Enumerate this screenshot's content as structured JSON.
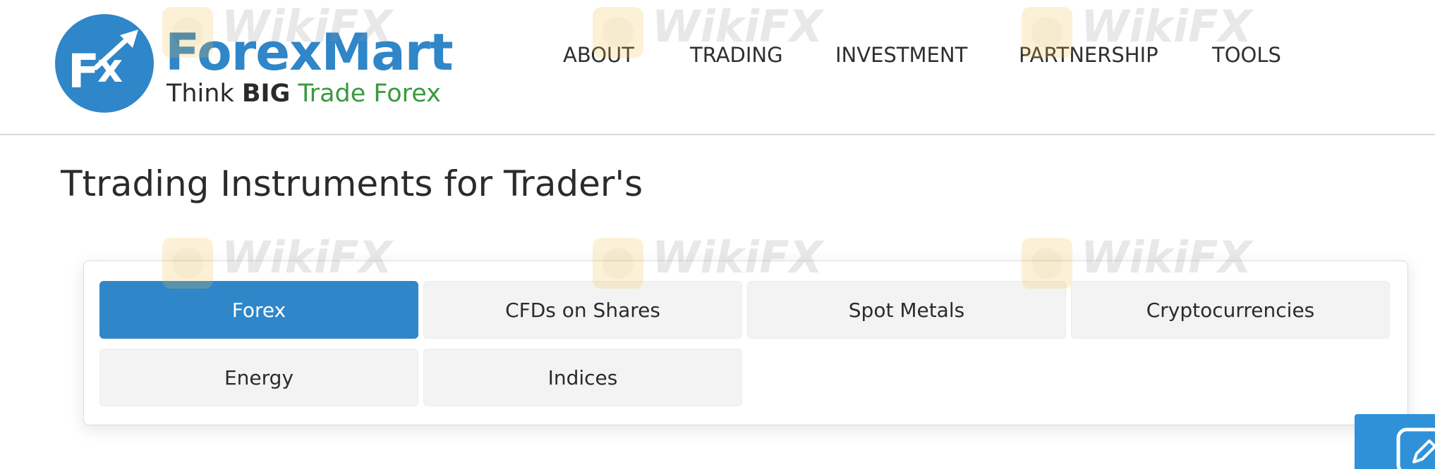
{
  "header": {
    "logo": {
      "wordmark": "ForexMart",
      "tagline_think": "Think ",
      "tagline_big": "BIG",
      "tagline_trade": " Trade Forex"
    },
    "nav": [
      {
        "label": "ABOUT"
      },
      {
        "label": "TRADING"
      },
      {
        "label": "INVESTMENT"
      },
      {
        "label": "PARTNERSHIP"
      },
      {
        "label": "TOOLS"
      }
    ]
  },
  "main": {
    "title": "Ttrading Instruments for Trader's",
    "tabs": [
      {
        "label": "Forex",
        "active": true
      },
      {
        "label": "CFDs on Shares",
        "active": false
      },
      {
        "label": "Spot Metals",
        "active": false
      },
      {
        "label": "Cryptocurrencies",
        "active": false
      },
      {
        "label": "Energy",
        "active": false
      },
      {
        "label": "Indices",
        "active": false
      }
    ]
  },
  "watermark": {
    "text": "WikiFX"
  },
  "floating_widget": {
    "icon": "edit-icon"
  },
  "colors": {
    "brand_blue": "#2f86c8",
    "brand_green": "#3a9a3e",
    "tab_bg": "#f3f3f3",
    "widget_blue": "#2f92d8"
  }
}
